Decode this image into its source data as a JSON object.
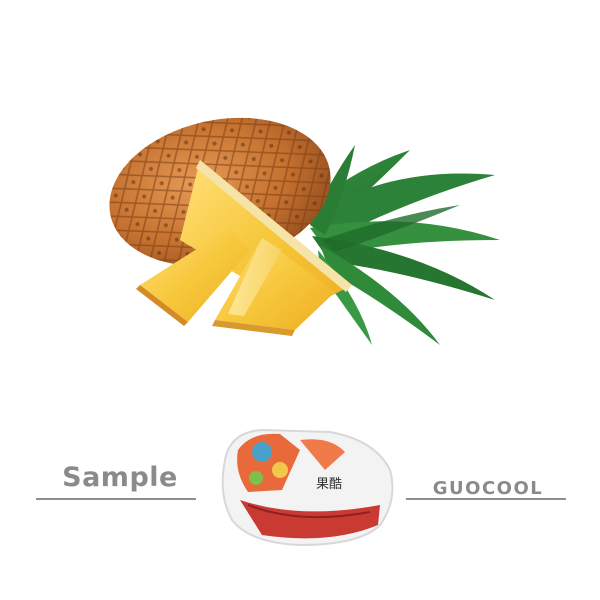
{
  "labels": {
    "sample": "Sample",
    "brand": "GUOCOOL"
  },
  "package": {
    "brand_text": "果酷"
  },
  "illustration": {
    "subject": "pineapple-with-slices",
    "colors": {
      "rind": "#c97a3a",
      "flesh": "#f6c63a",
      "leaves": "#2f8a3a",
      "product_red": "#c93a33",
      "tray": "#f2f2f2"
    }
  }
}
